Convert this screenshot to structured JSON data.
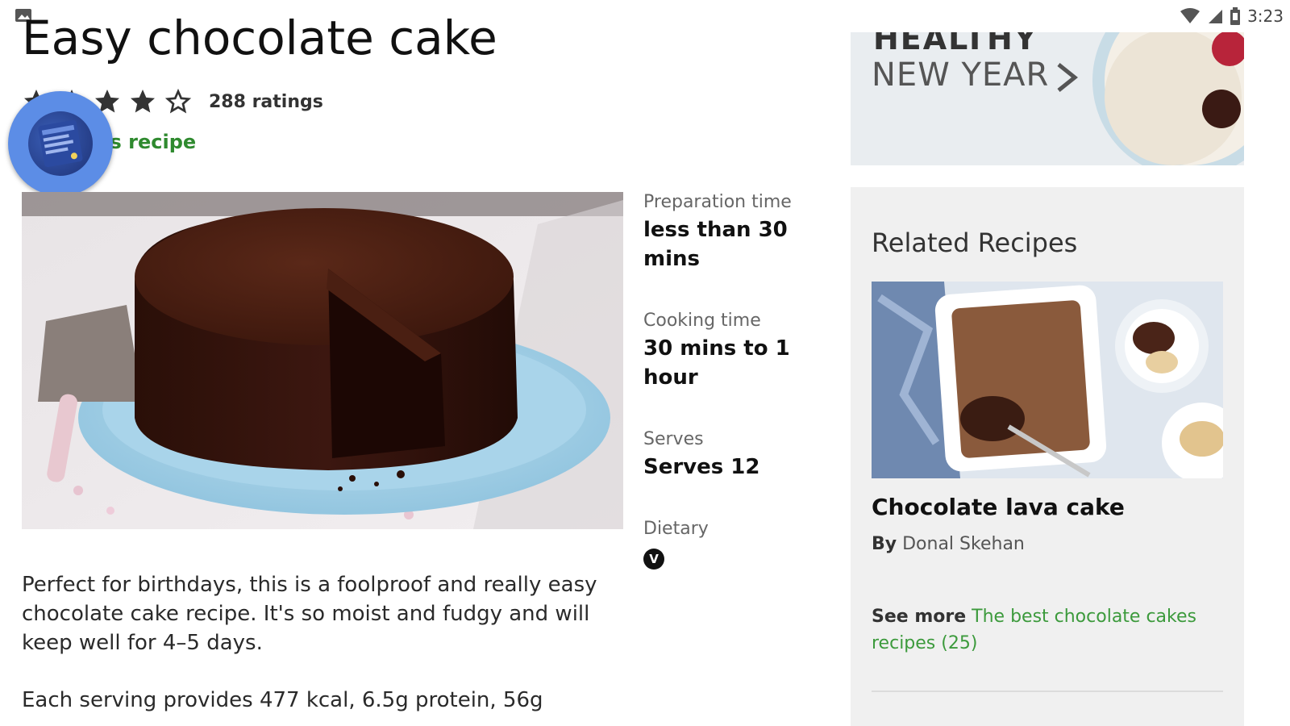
{
  "status_bar": {
    "time": "3:23"
  },
  "recipe": {
    "title": "Easy chocolate cake",
    "rating": {
      "stars_filled": 4,
      "stars_total": 5,
      "count_label": "288 ratings"
    },
    "save_label": "Save this recipe",
    "facts": [
      {
        "label": "Preparation time",
        "value": "less than 30 mins"
      },
      {
        "label": "Cooking time",
        "value": "30 mins to 1 hour"
      },
      {
        "label": "Serves",
        "value": "Serves 12"
      },
      {
        "label": "Dietary",
        "badge": "V"
      }
    ],
    "description": "Perfect for birthdays, this is a foolproof and really easy chocolate cake recipe. It's so moist and fudgy and will keep well for 4–5 days.",
    "nutrition": "Each serving provides 477 kcal, 6.5g protein, 56g"
  },
  "promo": {
    "line1": "HEALTHY",
    "line2": "NEW YEAR"
  },
  "related": {
    "heading": "Related Recipes",
    "item": {
      "title": "Chocolate lava cake",
      "author_prefix": "By",
      "author": "Donal Skehan"
    },
    "see_more_prefix": "See more",
    "see_more_link": "The best chocolate cakes recipes (25)"
  },
  "colors": {
    "link_green": "#2f8a2f",
    "avatar_blue": "#5c8de6",
    "panel_grey": "#f0f0f0"
  }
}
